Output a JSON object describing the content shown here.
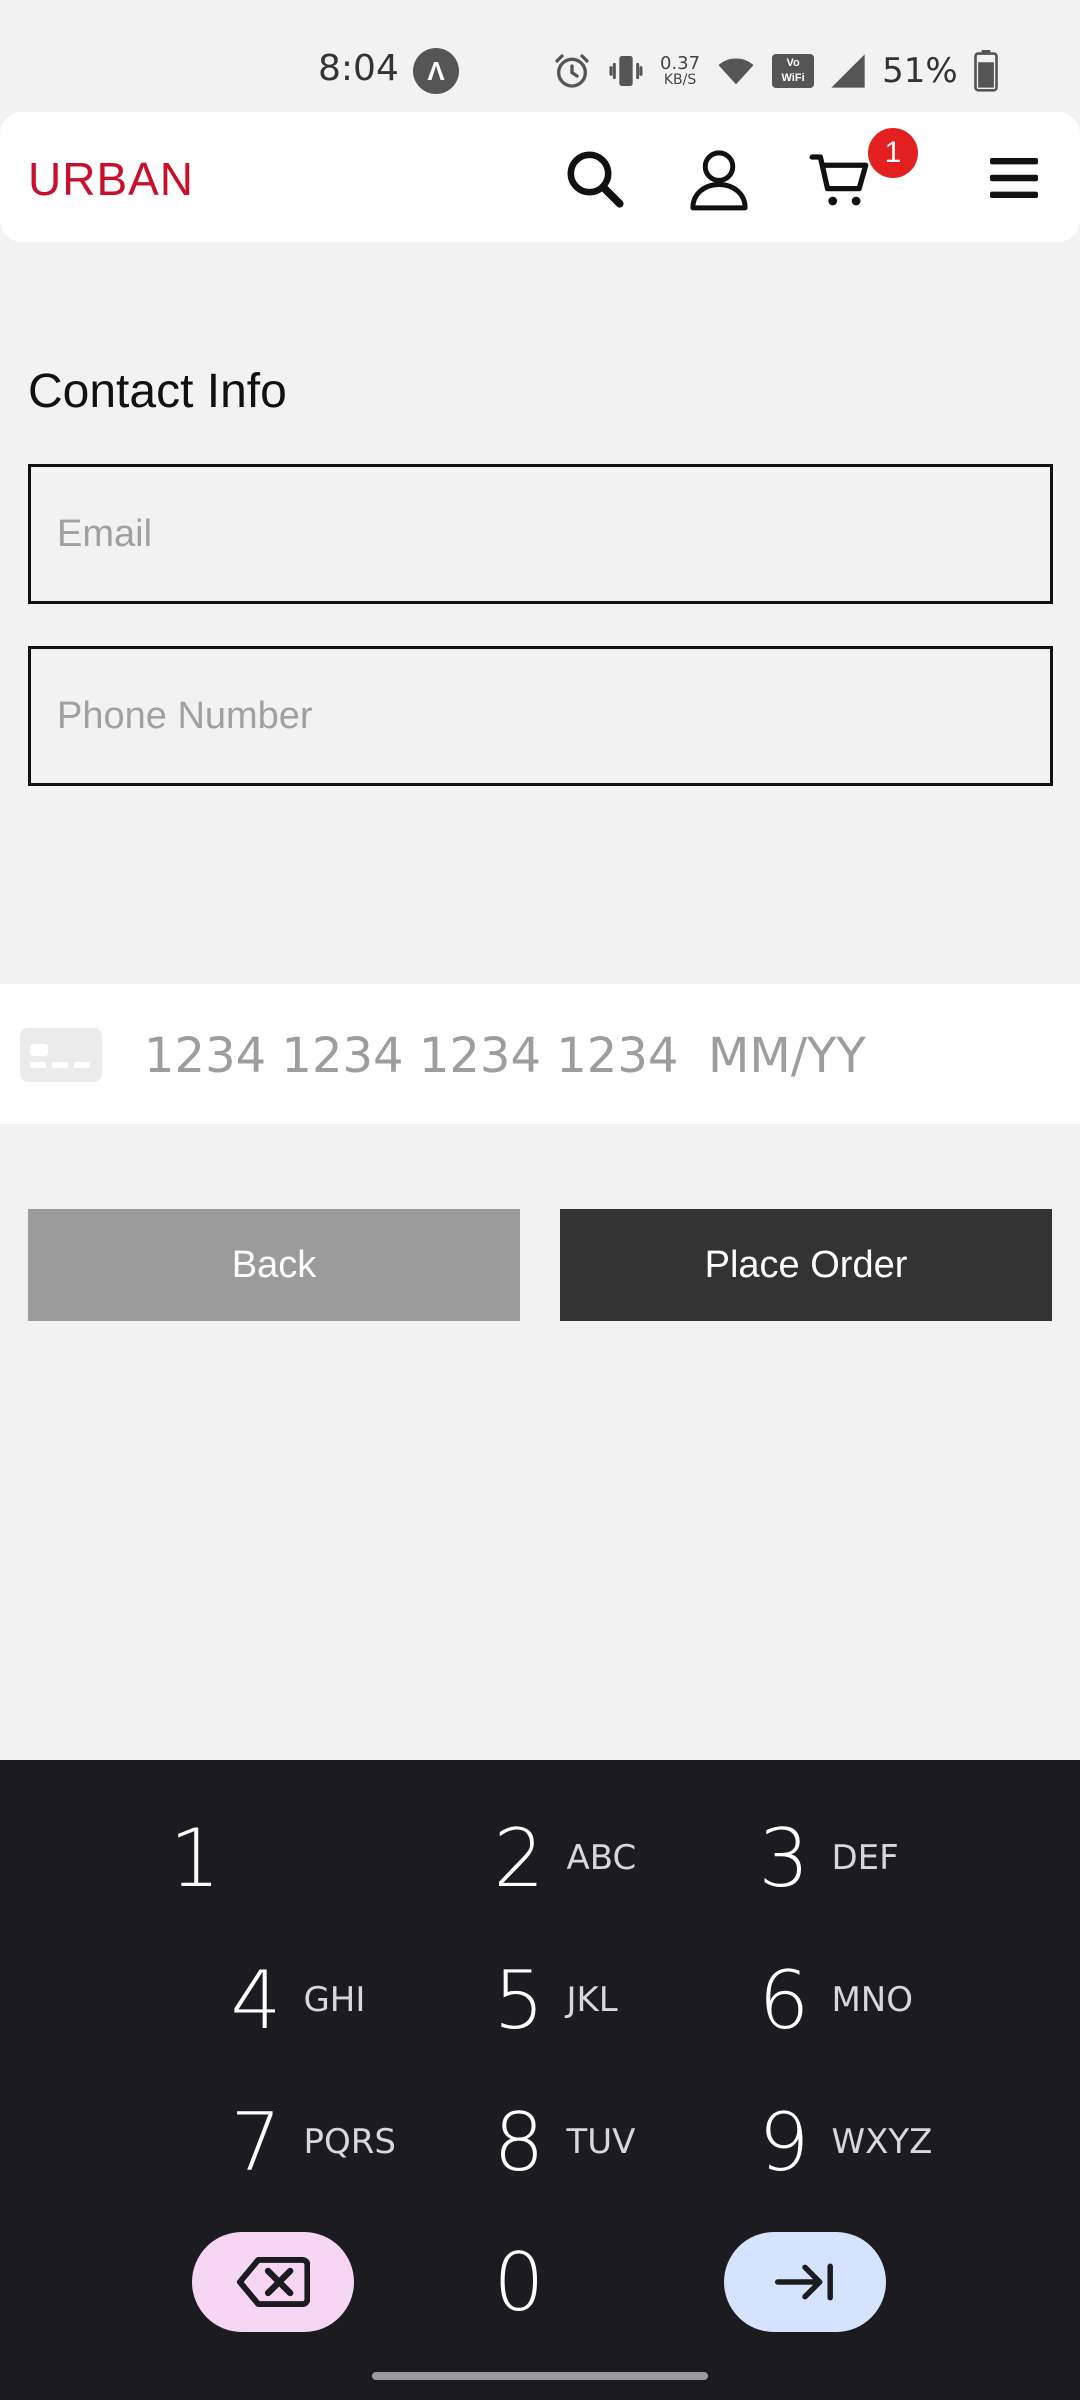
{
  "status_bar": {
    "time": "8:04",
    "app_indicator": "Λ",
    "net_speed_value": "0.37",
    "net_speed_unit": "KB/S",
    "vowifi_line1": "Vo",
    "vowifi_line2": "WiFi",
    "battery_percent": "51%",
    "icons": [
      "alarm-icon",
      "vibrate-icon",
      "wifi-icon",
      "vowifi-icon",
      "signal-icon",
      "battery-icon"
    ]
  },
  "header": {
    "brand": "URBAN",
    "cart_count": "1",
    "icons": [
      "search-icon",
      "account-icon",
      "cart-icon",
      "menu-icon"
    ],
    "brand_color": "#c8102e",
    "badge_color": "#e32020"
  },
  "contact": {
    "title": "Contact Info",
    "email_placeholder": "Email",
    "email_value": "",
    "phone_placeholder": "Phone Number",
    "phone_value": ""
  },
  "payment": {
    "card_number_placeholder": "1234 1234 1234 1234",
    "expiry_placeholder": "MM/YY"
  },
  "actions": {
    "back_label": "Back",
    "place_order_label": "Place Order",
    "back_color": "#9b9b9b",
    "order_color": "#333333"
  },
  "keypad": {
    "keys": [
      {
        "num": "1",
        "letters": ""
      },
      {
        "num": "2",
        "letters": "ABC"
      },
      {
        "num": "3",
        "letters": "DEF"
      },
      {
        "num": "4",
        "letters": "GHI"
      },
      {
        "num": "5",
        "letters": "JKL"
      },
      {
        "num": "6",
        "letters": "MNO"
      },
      {
        "num": "7",
        "letters": "PQRS"
      },
      {
        "num": "8",
        "letters": "TUV"
      },
      {
        "num": "9",
        "letters": "WXYZ"
      },
      {
        "num": "0",
        "letters": ""
      }
    ],
    "delete_color": "#f7d6f4",
    "next_color": "#d6e3ff"
  }
}
